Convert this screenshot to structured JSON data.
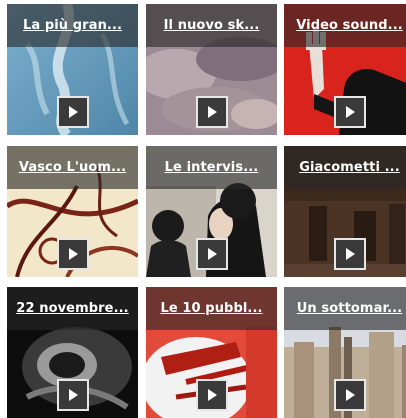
{
  "videos": [
    {
      "title": "La più gran...",
      "play_icon": "play-icon"
    },
    {
      "title": "Il nuovo sk...",
      "play_icon": "play-icon"
    },
    {
      "title": "Video sound...",
      "play_icon": "play-icon"
    },
    {
      "title": "Vasco L'uom...",
      "play_icon": "play-icon"
    },
    {
      "title": "Le intervis...",
      "play_icon": "play-icon"
    },
    {
      "title": "Giacometti ...",
      "play_icon": "play-icon"
    },
    {
      "title": "22 novembre...",
      "play_icon": "play-icon"
    },
    {
      "title": "Le 10 pubbl...",
      "play_icon": "play-icon"
    },
    {
      "title": "Un sottomar...",
      "play_icon": "play-icon"
    }
  ]
}
